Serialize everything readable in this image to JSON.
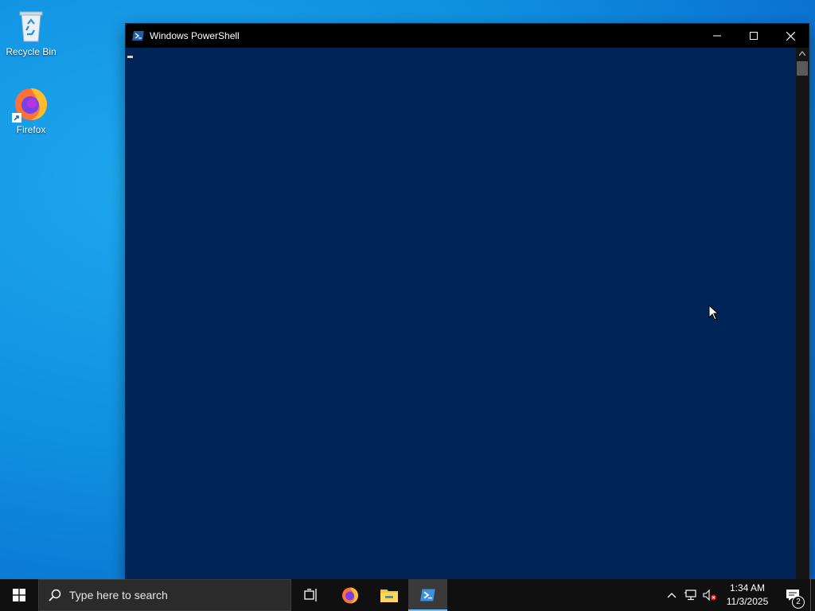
{
  "desktop": {
    "icons": [
      {
        "label": "Recycle Bin",
        "icon": "recycle-bin-icon"
      },
      {
        "label": "Firefox",
        "icon": "firefox-icon"
      }
    ]
  },
  "window": {
    "title": "Windows PowerShell",
    "icon": "powershell-icon",
    "controls": [
      "minimize",
      "maximize",
      "close"
    ],
    "background_color": "#012456"
  },
  "taskbar": {
    "search_placeholder": "Type here to search",
    "pinned": [
      "task-view-icon",
      "firefox-icon",
      "file-explorer-icon",
      "powershell-icon"
    ],
    "active_app": "powershell-icon",
    "clock": {
      "time": "1:34 AM",
      "date": "11/3/2025"
    },
    "notification_count": "2",
    "accent_color": "#76b9ed"
  }
}
